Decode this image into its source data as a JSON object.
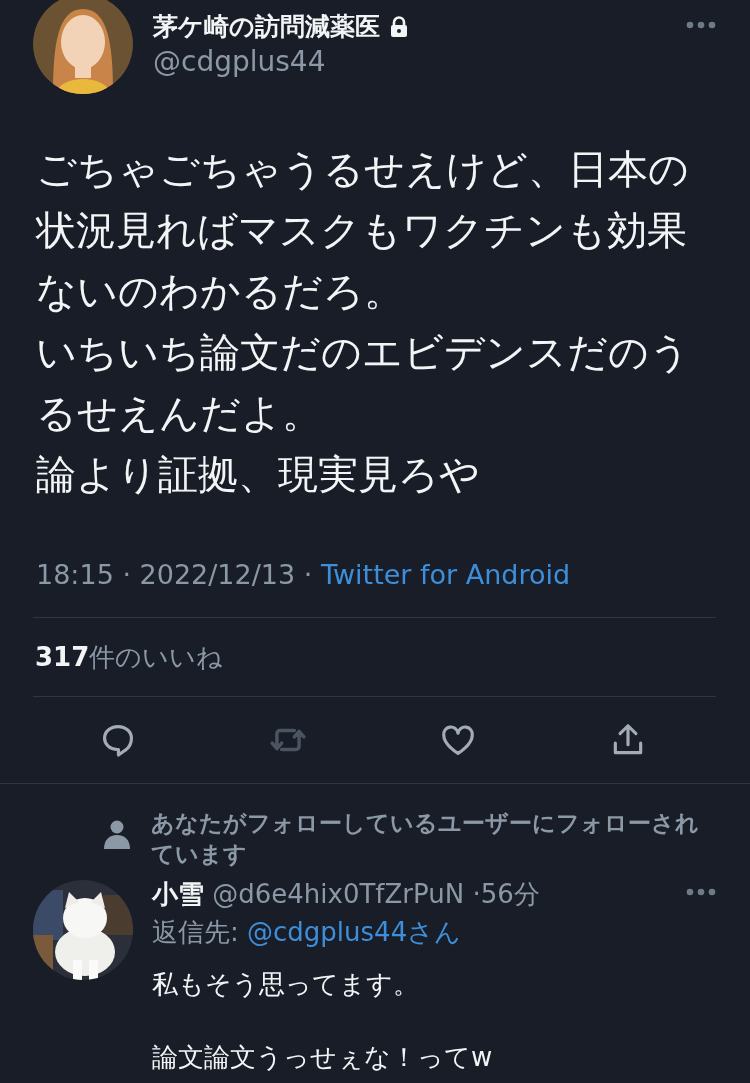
{
  "tweet": {
    "author": {
      "name": "茅ケ崎の訪問減薬医",
      "protected": true,
      "handle": "@cdgplus44"
    },
    "text_lines": [
      "ごちゃごちゃうるせえけど、日本の状況見ればマスクもワクチンも効果ないのわかるだろ。",
      "いちいち論文だのエビデンスだのうるせえんだよ。",
      "論より証拠、現実見ろや"
    ],
    "timestamp": "18:15 · 2022/12/13 ·",
    "source": "Twitter for Android",
    "likes": {
      "count": "317",
      "label": "件のいいね"
    },
    "actions": [
      {
        "kind": "reply",
        "disabled": false
      },
      {
        "kind": "retweet",
        "disabled": true
      },
      {
        "kind": "like",
        "disabled": false
      },
      {
        "kind": "share",
        "disabled": false
      }
    ]
  },
  "reply": {
    "social_context": "あなたがフォローしているユーザーにフォローされています",
    "author": {
      "name": "小雪",
      "handle": "@d6e4hix0TfZrPuN"
    },
    "separator": "·",
    "time": "56分",
    "reply_to_label": "返信先:",
    "reply_to": "@cdgplus44さん",
    "paragraphs": [
      "私もそう思ってます。",
      "論文論文うっせぇな！ってw"
    ]
  }
}
